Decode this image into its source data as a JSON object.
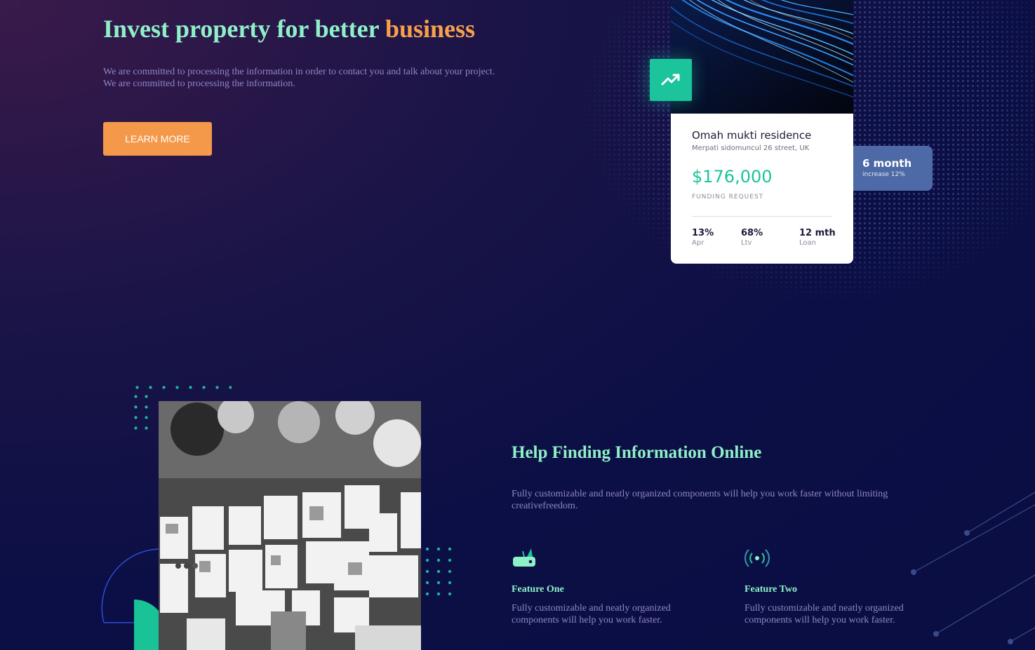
{
  "hero": {
    "title_main": "Invest property for better ",
    "title_accent": "business",
    "description": "We are committed to processing the information in order to contact you and talk about your project. We are committed to processing the information.",
    "button_label": "LEARN MORE"
  },
  "property_card": {
    "name": "Omah mukti residence",
    "address": "Merpati sidomuncul 26 street, UK",
    "price": "$176,000",
    "price_label": "FUNDING REQUEST",
    "stats": [
      {
        "value": "13%",
        "label": "Apr"
      },
      {
        "value": "68%",
        "label": "Ltv"
      },
      {
        "value": "12 mth",
        "label": "Loan"
      }
    ],
    "badge": {
      "title": "6 month",
      "subtitle": "increase 12%"
    },
    "trend_icon": "trending-up-icon"
  },
  "info_section": {
    "title": "Help Finding Information Online",
    "description": "Fully customizable and neatly organized components will help you work faster without limiting creativefreedom.",
    "features": [
      {
        "icon": "router-icon",
        "title": "Feature One",
        "description": "Fully customizable and neatly organized components will help you work faster."
      },
      {
        "icon": "broadcast-icon",
        "title": "Feature Two",
        "description": "Fully customizable and neatly organized components will help you work faster."
      }
    ]
  },
  "colors": {
    "accent_teal": "#8ff0c8",
    "accent_orange": "#f4994a",
    "green": "#1bc49a",
    "text_muted": "#8f86c4",
    "badge_blue": "#4d6aa6"
  }
}
